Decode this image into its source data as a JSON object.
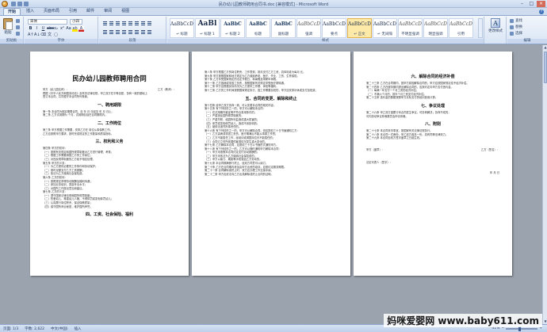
{
  "window": {
    "title": "民办幼儿园教师聘用合同书.doc [兼容模式] - Microsoft Word"
  },
  "tabs": [
    "开始",
    "插入",
    "页面布局",
    "引用",
    "邮件",
    "审阅",
    "视图"
  ],
  "ribbon": {
    "clipboard": {
      "paste_label": "粘贴",
      "group_label": "剪贴板"
    },
    "font": {
      "font_name": "宋体",
      "font_size": "小四",
      "group_label": "字体"
    },
    "paragraph": {
      "group_label": "段落"
    },
    "styles": {
      "group_label": "样式",
      "items": [
        {
          "sample": "AaBbCcDd",
          "name": "↵ 标题"
        },
        {
          "sample": "AaBl",
          "name": "↵ 标题 1"
        },
        {
          "sample": "AaBbC",
          "name": "↵ 标题 2"
        },
        {
          "sample": "AaBbC",
          "name": "标题"
        },
        {
          "sample": "AaBbC",
          "name": "副标题"
        },
        {
          "sample": "AaBbCcDd",
          "name": "强调"
        },
        {
          "sample": "AaBbCcDd",
          "name": "要点"
        },
        {
          "sample": "AaBbCcDd",
          "name": "↵ 正文"
        },
        {
          "sample": "AaBbCcDd",
          "name": "↵ 无间隔"
        },
        {
          "sample": "AaBbCcDd",
          "name": "不明显强调"
        },
        {
          "sample": "AaBbCcDd",
          "name": "明显强调"
        },
        {
          "sample": "AaBbCcDd",
          "name": "引用"
        },
        {
          "sample": "AaBbCcDd",
          "name": "明显引用"
        },
        {
          "sample": "AaBbCcDd",
          "name": "不明显参考"
        }
      ]
    },
    "change_styles": "更改样式",
    "editing": {
      "group_label": "编辑",
      "find": "查找",
      "replace": "替换",
      "select": "选择"
    }
  },
  "pages": [
    {
      "title": "民办幼儿园教师聘用合同",
      "meta_left": "甲方（幼儿园名称）：",
      "meta_right": "乙方（教师）：",
      "lines_top": [
        "根据《中华人民共和国劳动法》及有关法律法规，甲乙双方在平等自愿、协商一致的基础上",
        "签订本合同，共同遵守本合同所列条款。"
      ],
      "sec1": "一、聘用期限",
      "lines_sec1": [
        "第一条 本合同为固定期限合同，自 年 月 日起至 年 月 日止。",
        "第二条 乙方试用期为 个月，试用期包括在合同期限内。"
      ],
      "sec2": "二、工作岗位",
      "lines_sec2": [
        "第三条 甲方根据工作需要，安排乙方在 岗位从事保教工作。",
        "乙方应按照甲方要求，按时完成规定的工作数量和质量指标。"
      ],
      "sec3": "三、权利和义务",
      "lines_sec3": [
        "第四条 甲方的权利：",
        "（一）按照有关规定和园所规章制度对乙方进行管理、考核；",
        "（二）根据工作需要调整乙方的工作岗位；",
        "（三）对违反规章制度的乙方给予相应处理。",
        "第五条 甲方的义务：",
        "（一）为乙方提供必要的工作条件和劳动保护；",
        "（二）按时足额支付乙方工资报酬；",
        "（三）依法为乙方缴纳社会保险费。",
        "第六条 乙方的权利：",
        "（一）按照规定获得劳动报酬及福利待遇；",
        "（二）参加业务培训，提高专业水平；",
        "（三）对园所工作提出意见和建议。",
        "第七条 乙方的义务：",
        "（一）遵守国家法律法规和园所规章制度；",
        "（二）热爱幼儿，尊重幼儿人格，不得体罚或变相体罚幼儿；",
        "（三）认真履行岗位职责，保证保教质量；",
        "（四）保守园所商业秘密，维护园所声誉。"
      ],
      "sec4": "四、工资、社会保险、福利"
    },
    {
      "sec5": "五、合同的变更、解除和终止",
      "lines_a": [
        "第八条 甲方根据乙方的岗位职责、工作表现，按月支付乙方工资，具体标准为每月 元。",
        "第九条 甲方按照国家和地方规定为乙方缴纳养老、医疗、失业、工伤、生育保险。",
        "第十条 乙方享受国家规定的法定节假日、寒暑假及带薪年休假。",
        "第十一条 乙方因病或非因工负伤，按照国家有关规定享受医疗期待遇。",
        "第十二条 甲方应根据实际情况为乙方提供工作餐、体检等福利。",
        "第十三条 乙方的工作时间按照国家规定执行，因工作需要加班的，甲方应安排补休或支付加班费。"
      ],
      "lines_b": [
        "第十四条 经甲乙双方协商一致，可以变更本合同的相关内容。",
        "第十五条 有下列情形之一的，甲方可以解除本合同：",
        "（一）在试用期内被证明不符合录用条件的；",
        "（二）严重违反园所规章制度的；",
        "（三）严重失职，给园所利益造成重大损害的；",
        "（四）体罚或变相体罚幼儿，造成不良影响的；",
        "（五）被依法追究刑事责任的。",
        "第十六条 有下列情形之一的，甲方可以解除合同，但应提前三十日书面通知乙方：",
        "（一）乙方患病或非因工负伤，医疗期满后不能从事原工作的；",
        "（二）乙方不能胜任工作，经培训或调整岗位仍不能胜任的；",
        "（三）合同订立时所依据的客观情况发生重大变化的。",
        "第十七条 乙方解除本合同，应提前三十日以书面形式通知甲方。",
        "第十八条 有下列情形之一的，乙方可以随时通知甲方解除本合同：",
        "（一）甲方未按照本合同约定支付劳动报酬的；",
        "（二）甲方未依法为乙方缴纳社会保险费的；",
        "（三）甲方以暴力、威胁等手段强迫乙方劳动的。",
        "第十九条 本合同期满即行终止，经双方同意可以续订。",
        "第二十条 乙方在合同期内参加由甲方出资的培训，应按约定服务期限。",
        "第二十一条 合同解除或终止时，双方应办理工作交接手续。",
        "第二十二条 甲方应依法向乙方出具解除或终止合同的证明。"
      ]
    },
    {
      "sec6": "六、解除合同的经济补偿",
      "lines_a": [
        "第二十三条 乙方在合同期内，因甲方原因解除合同的，甲方应按国家规定给予经济补偿。",
        "第二十四条 乙方在服务期内提出解除合同的，应按约定向甲方支付违约金。",
        "（一）每满一年支付一个月工资的经济补偿；",
        "（二）不满六个月的，按半个月工资支付经济补偿。",
        "第二十五条 违约金的数额按照甲方实际支付的培训费用计算。"
      ],
      "sec7": "七、争议处理",
      "lines_b": [
        "第二十六条 甲乙双方因履行本合同发生争议，可协商解决；协商不成的，",
        "可向劳动争议仲裁委员会申请仲裁。"
      ],
      "sec8": "八、附则",
      "lines_c": [
        "第二十七条 本合同未尽事宜，按国家有关法律法规执行。",
        "第二十八条 本合同一式两份，甲乙双方各执一份，具有同等法律效力。",
        "第二十九条 本合同自双方签字盖章之日起生效。"
      ],
      "sign_left": "甲方（盖章）：",
      "sign_right": "乙方（签名）：",
      "sign_rep": "法定代表人（签字）：",
      "sign_date": "年  月  日"
    }
  ],
  "status": {
    "page": "页面: 1/3",
    "words": "字数: 2,622",
    "lang": "中文(中国)",
    "mode": "插入",
    "zoom": "41%"
  },
  "watermark": "妈咪爱婴网 www.baby611.com"
}
